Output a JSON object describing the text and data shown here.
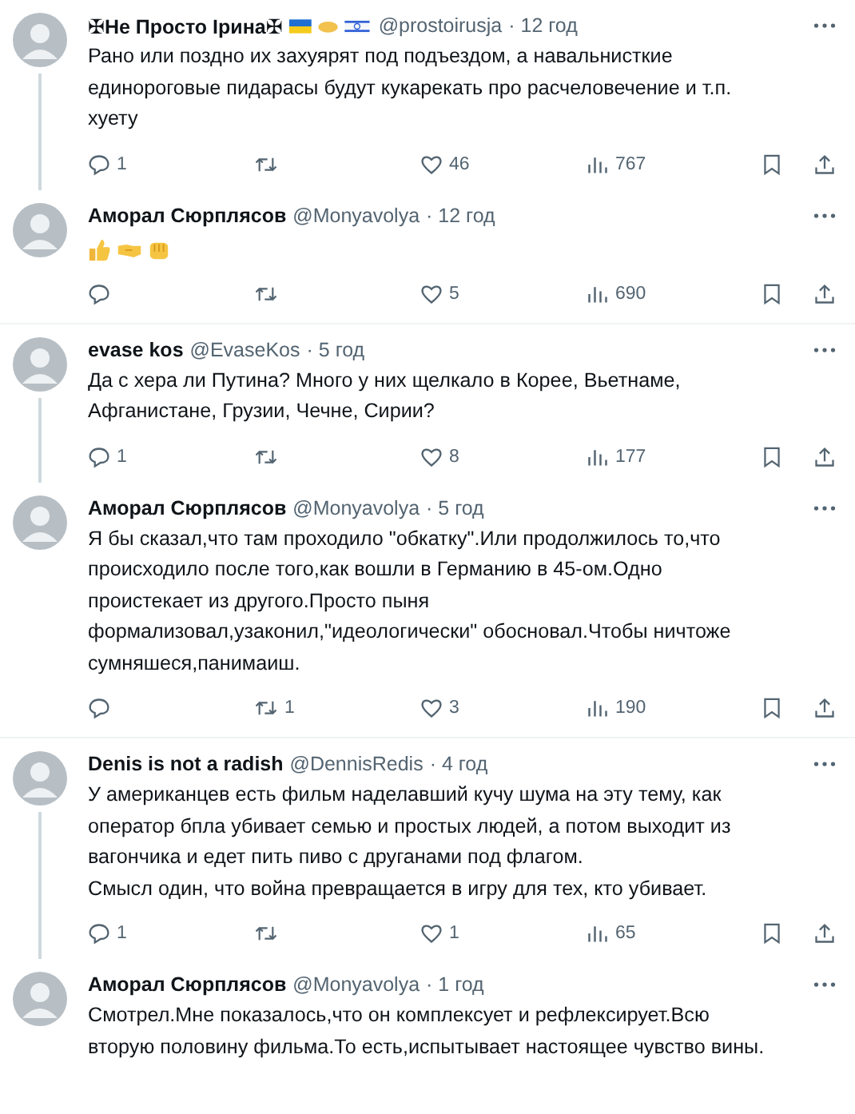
{
  "tweets": [
    {
      "name": "✠Не Просто Ірина✠",
      "name_flags": true,
      "handle": "@prostoirusja",
      "time": "· 12 год",
      "connected": true,
      "kind": "text",
      "text": "Рано или поздно их захуярят под подъездом, а навальнисткие\nединороговые пидарасы будут кукарекать про расчеловечение и т.п.\nхуету",
      "replies": "1",
      "likes": "46",
      "views": "767"
    },
    {
      "name": "Аморал Сюрплясов",
      "handle": "@Monyavolya",
      "time": "· 12 год",
      "connected": false,
      "kind": "emoji",
      "likes": "5",
      "views": "690"
    },
    {
      "name": "evase kos",
      "handle": "@EvaseKos",
      "time": "· 5 год",
      "connected": true,
      "kind": "text",
      "text": "Да с хера ли Путина? Много у них щелкало в Корее, Вьетнаме,\nАфганистане, Грузии, Чечне, Сирии?",
      "replies": "1",
      "likes": "8",
      "views": "177"
    },
    {
      "name": "Аморал Сюрплясов",
      "handle": "@Monyavolya",
      "time": "· 5 год",
      "connected": false,
      "kind": "text",
      "text": "Я бы сказал,что там проходило \"обкатку\".Или продолжилось то,что\nпроисходило после того,как вошли в Германию в 45-ом.Одно\nпроистекает из другого.Просто пыня\nформализовал,узаконил,\"идеологически\" обосновал.Чтобы ничтоже\nсумняшеся,панимаиш.",
      "reposts": "1",
      "likes": "3",
      "views": "190"
    },
    {
      "name": "Denis is not a radish",
      "handle": "@DennisRedis",
      "time": "· 4 год",
      "connected": true,
      "kind": "text",
      "text": "У американцев есть фильм наделавший кучу шума на эту тему, как\nоператор бпла убивает семью и простых людей, а потом выходит из\nвагончика и едет пить пиво с друганами под флагом.\nСмысл один, что война превращается в игру для тех, кто убивает.",
      "replies": "1",
      "likes": "1",
      "views": "65"
    },
    {
      "name": "Аморал Сюрплясов",
      "handle": "@Monyavolya",
      "time": "· 1 год",
      "connected": false,
      "kind": "text",
      "text": "Смотрел.Мне показалось,что он комплексует и рефлексирует.Всю\nвторую половину фильма.То есть,испытывает настоящее чувство вины.",
      "actions": false
    }
  ]
}
